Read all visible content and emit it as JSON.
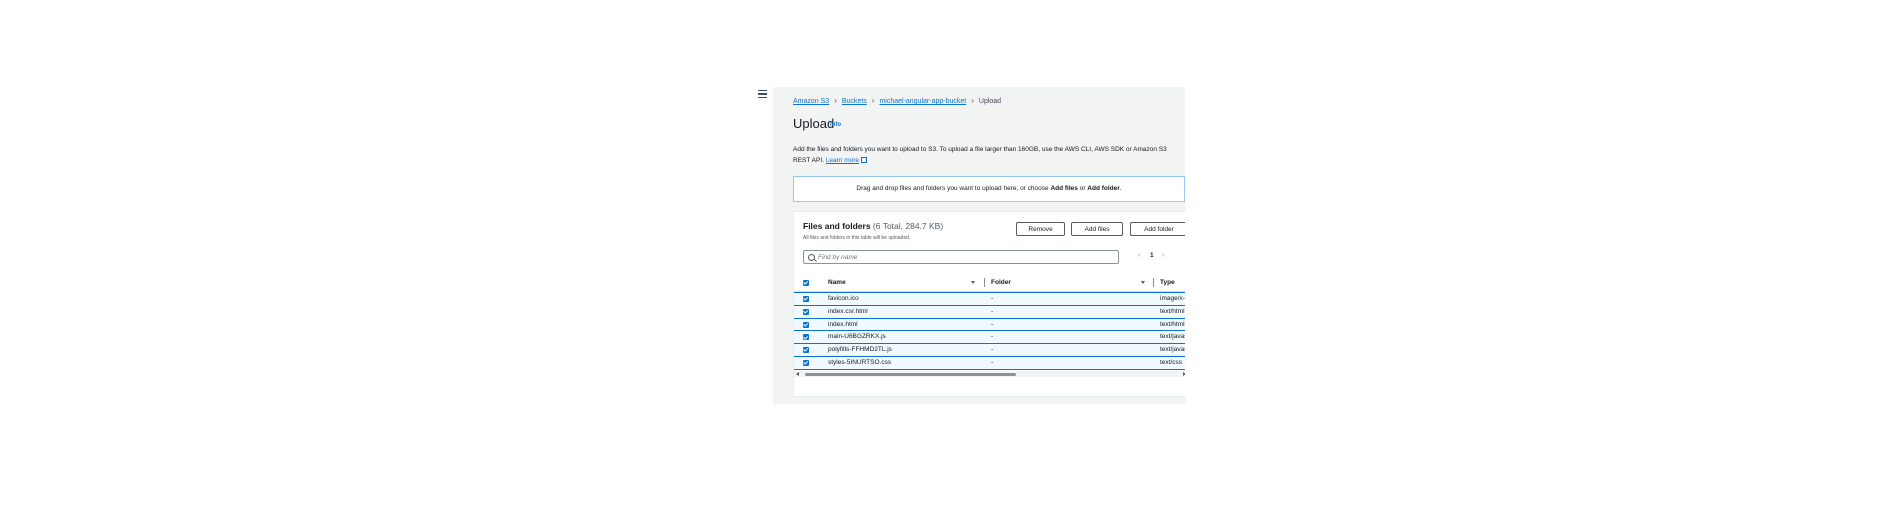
{
  "breadcrumb": [
    {
      "label": "Amazon S3",
      "link": true
    },
    {
      "label": "Buckets",
      "link": true
    },
    {
      "label": "michael-angular-app-bucket",
      "link": true
    },
    {
      "label": "Upload",
      "link": false
    }
  ],
  "page": {
    "title": "Upload",
    "info": "Info",
    "description_text": "Add the files and folders you want to upload to S3. To upload a file larger than 160GB, use the AWS CLI, AWS SDK or Amazon S3 REST API.",
    "learn_more": "Learn more"
  },
  "dropzone": {
    "text_before": "Drag and drop files and folders you want to upload here, or choose",
    "add_files": "Add files",
    "or": "or",
    "add_folder": "Add folder",
    "end": "."
  },
  "files_panel": {
    "title": "Files and folders",
    "count": "(6 Total, 284.7 KB)",
    "subtitle": "All files and folders in this table will be uploaded.",
    "buttons": {
      "remove": "Remove",
      "add_files": "Add files",
      "add_folder": "Add folder"
    },
    "search_placeholder": "Find by name",
    "page_number": "1",
    "columns": {
      "name": "Name",
      "folder": "Folder",
      "type": "Type"
    },
    "rows": [
      {
        "name": "favicon.ico",
        "folder": "-",
        "type": "image/x-icon",
        "checked": true
      },
      {
        "name": "index.csr.html",
        "folder": "-",
        "type": "text/html",
        "checked": true
      },
      {
        "name": "index.html",
        "folder": "-",
        "type": "text/html",
        "checked": true
      },
      {
        "name": "main-U6BGZRKX.js",
        "folder": "-",
        "type": "text/javascript",
        "checked": true
      },
      {
        "name": "polyfills-FFHMD2TL.js",
        "folder": "-",
        "type": "text/javascript",
        "checked": true
      },
      {
        "name": "styles-5INURTSO.css",
        "folder": "-",
        "type": "text/css",
        "checked": true
      }
    ]
  },
  "icons": {
    "menu": "hamburger-menu-icon",
    "breadcrumb_sep": "chevron-right-icon",
    "external": "external-link-icon",
    "search": "search-icon",
    "prev": "chevron-left-icon",
    "next": "chevron-right-icon",
    "sort": "sort-down-icon"
  },
  "colors": {
    "link": "#0972d3",
    "selected_row": "#f1faff",
    "checkbox": "#0972d3",
    "background": "#f2f3f3"
  }
}
